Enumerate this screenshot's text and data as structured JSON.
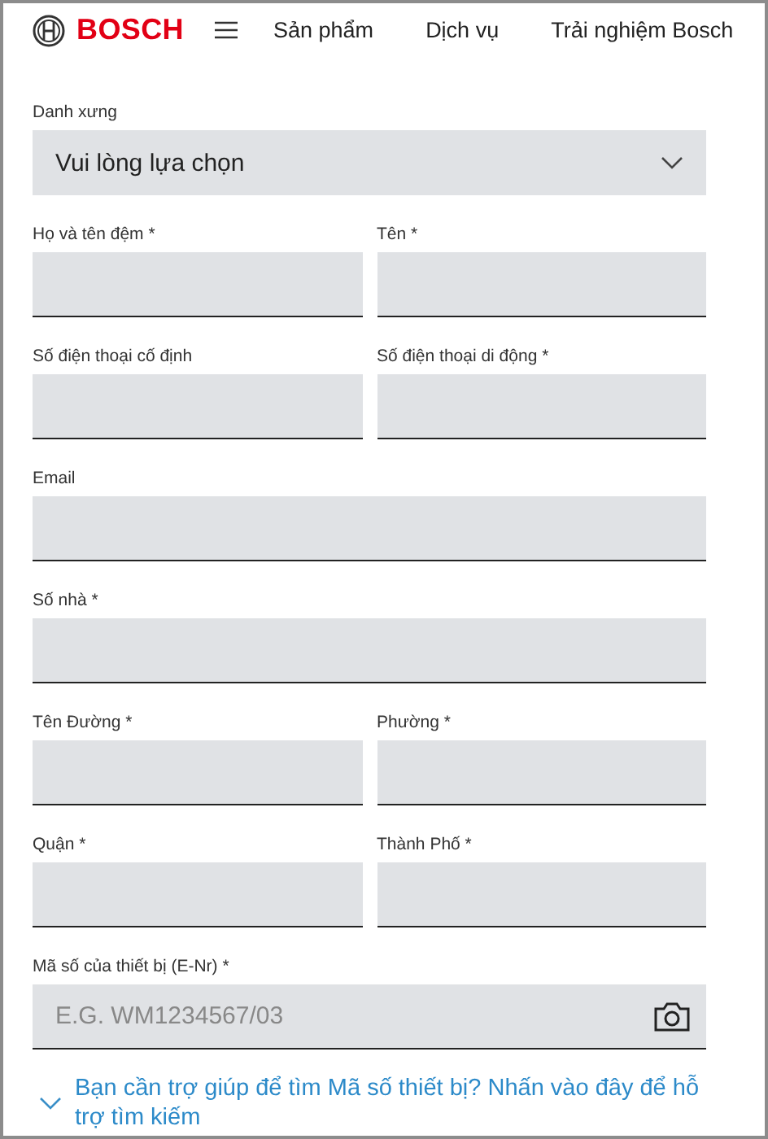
{
  "header": {
    "brand": "BOSCH",
    "nav": [
      "Sản phẩm",
      "Dịch vụ",
      "Trải nghiệm Bosch"
    ]
  },
  "form": {
    "rows": [
      {
        "fields": [
          {
            "kind": "select",
            "label": "Danh xưng",
            "value": "Vui lòng lựa chọn"
          }
        ]
      },
      {
        "fields": [
          {
            "kind": "text",
            "label": "Họ và tên đệm *"
          },
          {
            "kind": "text",
            "label": "Tên *"
          }
        ]
      },
      {
        "fields": [
          {
            "kind": "text",
            "label": "Số điện thoại cố định"
          },
          {
            "kind": "text",
            "label": "Số điện thoại di động *"
          }
        ]
      },
      {
        "fields": [
          {
            "kind": "text",
            "label": "Email"
          }
        ]
      },
      {
        "fields": [
          {
            "kind": "text",
            "label": "Số nhà *"
          }
        ]
      },
      {
        "fields": [
          {
            "kind": "text",
            "label": "Tên Đường *"
          },
          {
            "kind": "text",
            "label": "Phường *"
          }
        ]
      },
      {
        "fields": [
          {
            "kind": "text",
            "label": "Quận *"
          },
          {
            "kind": "text",
            "label": "Thành Phố *"
          }
        ]
      },
      {
        "fields": [
          {
            "kind": "camera",
            "label": "Mã số của thiết bị (E-Nr) *",
            "placeholder": "E.G. WM1234567/03"
          }
        ]
      }
    ],
    "help_link": "Bạn cần trợ giúp để tìm Mã số thiết bị? Nhấn vào đây để hỗ trợ tìm kiếm"
  }
}
